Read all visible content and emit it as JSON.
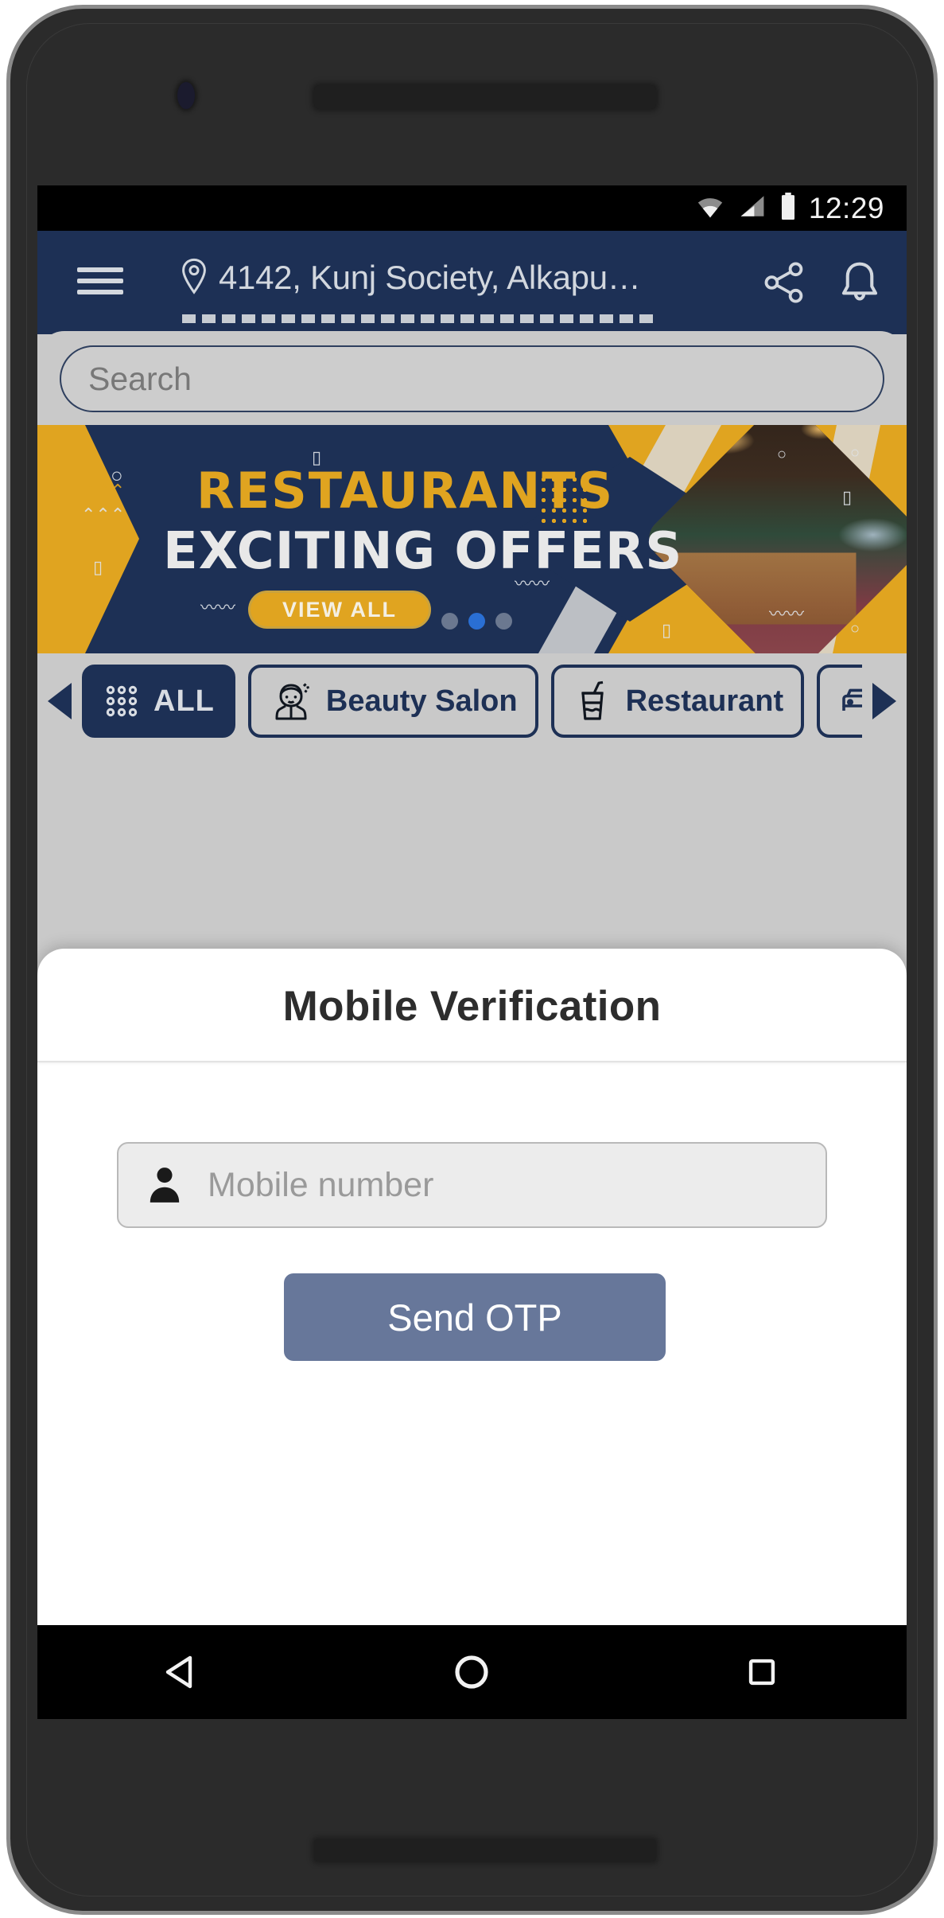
{
  "device": {
    "frame_color": "#2b2b2b",
    "bezel_edge_color": "#8a8a8a"
  },
  "status_bar": {
    "time": "12:29",
    "icons": [
      "wifi-icon",
      "cellular-signal-icon",
      "battery-icon"
    ],
    "background": "#000000"
  },
  "app_bar": {
    "background": "#1d3055",
    "menu_icon": "hamburger-menu-icon",
    "location_icon": "location-pin-icon",
    "address": "4142, Kunj Society, Alkapu…",
    "share_icon": "share-icon",
    "notification_icon": "bell-icon"
  },
  "search": {
    "placeholder": "Search",
    "value": ""
  },
  "banner": {
    "title": "RESTAURANTS",
    "subtitle": "EXCITING OFFERS",
    "cta_label": "VIEW ALL",
    "accent_color": "#e0a420",
    "navy_color": "#1d3055",
    "dots": 3,
    "active_dot": 2
  },
  "categories": {
    "prev_arrow": "chevron-left-icon",
    "next_arrow": "chevron-right-icon",
    "items": [
      {
        "label": "ALL",
        "icon": "grid-dots-icon",
        "active": true
      },
      {
        "label": "Beauty Salon",
        "icon": "beautician-icon",
        "active": false
      },
      {
        "label": "Restaurant",
        "icon": "fastfood-icon",
        "active": false
      },
      {
        "label": "",
        "icon": "car-icon",
        "active": false
      }
    ]
  },
  "dialog": {
    "title": "Mobile Verification",
    "mobile_field": {
      "icon": "person-icon",
      "placeholder": "Mobile number",
      "value": ""
    },
    "send_otp_label": "Send OTP",
    "send_otp_color": "#67779a"
  },
  "android_nav": {
    "back": "back-triangle-icon",
    "home": "home-circle-icon",
    "recents": "recents-square-icon"
  }
}
